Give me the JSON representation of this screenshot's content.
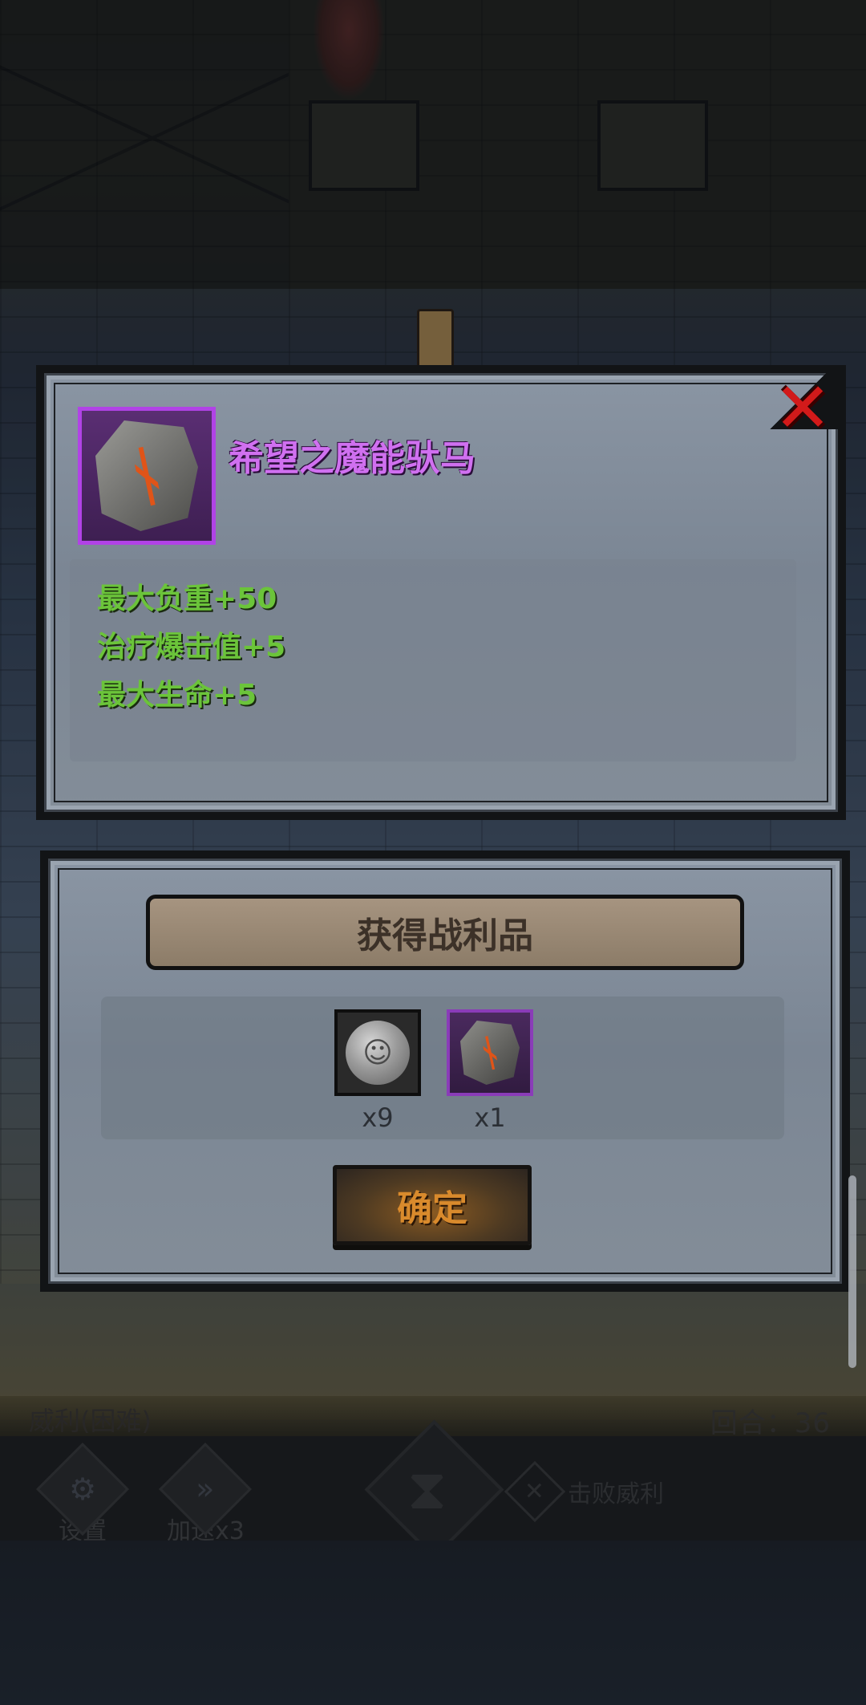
{
  "item_popup": {
    "title": "希望之魔能驮马",
    "rarity_color": "#b143e6",
    "icon": "rune-stone-icon",
    "close_icon": "close-x-icon",
    "stats": [
      "最大负重+50",
      "治疗爆击值+5",
      "最大生命+5"
    ]
  },
  "loot_popup": {
    "banner": "获得战利品",
    "items": [
      {
        "icon": "silver-coin-icon",
        "count": "x9"
      },
      {
        "icon": "rune-stone-icon",
        "count": "x1"
      }
    ],
    "confirm_label": "确定"
  },
  "status": {
    "enemy": "威利(困难)",
    "round": "回合：36"
  },
  "toolbar": {
    "settings_label": "设置",
    "speed_label": "加速x3",
    "hint_label": "击败威利"
  },
  "colors": {
    "stat_green": "#6bc43a",
    "close_red": "#d21a1a",
    "confirm_orange": "#d98a2c"
  }
}
